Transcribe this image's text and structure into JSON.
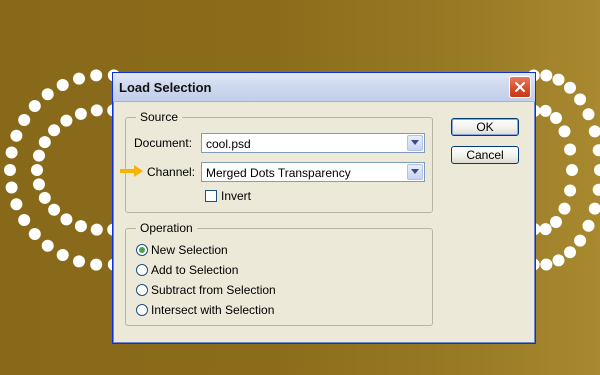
{
  "dialog": {
    "title": "Load Selection",
    "source": {
      "legend": "Source",
      "document_label": "Document:",
      "document_value": "cool.psd",
      "channel_label": "Channel:",
      "channel_value": "Merged Dots Transparency",
      "invert_label": "Invert",
      "invert_checked": false
    },
    "operation": {
      "legend": "Operation",
      "options": [
        "New Selection",
        "Add to Selection",
        "Subtract from Selection",
        "Intersect with Selection"
      ],
      "selected": "New Selection"
    },
    "buttons": {
      "ok": "OK",
      "cancel": "Cancel"
    }
  },
  "colors": {
    "canvas": "#8a6c1a",
    "dots": "#ffffff",
    "dialog_bg": "#ece9d8",
    "pointer_arrow": "#f4b400"
  },
  "icons": {
    "close": "close-icon",
    "dropdown": "chevron-down-icon",
    "pointer": "arrow-right-icon"
  }
}
